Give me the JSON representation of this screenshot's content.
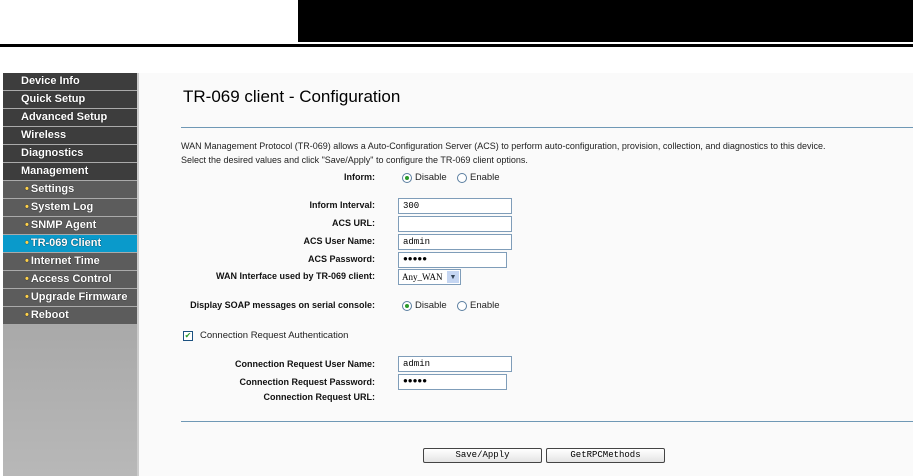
{
  "sidebar": {
    "items": [
      {
        "label": "Device Info"
      },
      {
        "label": "Quick Setup"
      },
      {
        "label": "Advanced Setup"
      },
      {
        "label": "Wireless"
      },
      {
        "label": "Diagnostics"
      },
      {
        "label": "Management"
      },
      {
        "label": "Settings"
      },
      {
        "label": "System Log"
      },
      {
        "label": "SNMP Agent"
      },
      {
        "label": "TR-069 Client"
      },
      {
        "label": "Internet Time"
      },
      {
        "label": "Access Control"
      },
      {
        "label": "Upgrade Firmware"
      },
      {
        "label": "Reboot"
      }
    ],
    "active": "TR-069 Client"
  },
  "page": {
    "title": "TR-069 client - Configuration",
    "desc1": "WAN Management Protocol (TR-069) allows a Auto-Configuration Server (ACS) to perform auto-configuration, provision, collection, and diagnostics to this device.",
    "desc2": "Select the desired values and click \"Save/Apply\" to configure the TR-069 client options."
  },
  "form": {
    "inform_label": "Inform:",
    "disable": "Disable",
    "enable": "Enable",
    "interval_label": "Inform Interval:",
    "interval": "300",
    "acs_url_label": "ACS URL:",
    "acs_url": "",
    "acs_user_label": "ACS User Name:",
    "acs_user": "admin",
    "acs_pw_label": "ACS Password:",
    "acs_pw": "●●●●●",
    "wan_label": "WAN Interface used by TR-069 client:",
    "wan": "Any_WAN",
    "soap_label": "Display SOAP messages on serial console:",
    "cra_label": "Connection Request Authentication",
    "cr_user_label": "Connection Request User Name:",
    "cr_user": "admin",
    "cr_pw_label": "Connection Request Password:",
    "cr_pw": "●●●●●",
    "cr_url_label": "Connection Request URL:"
  },
  "buttons": {
    "save": "Save/Apply",
    "rpc": "GetRPCMethods"
  }
}
